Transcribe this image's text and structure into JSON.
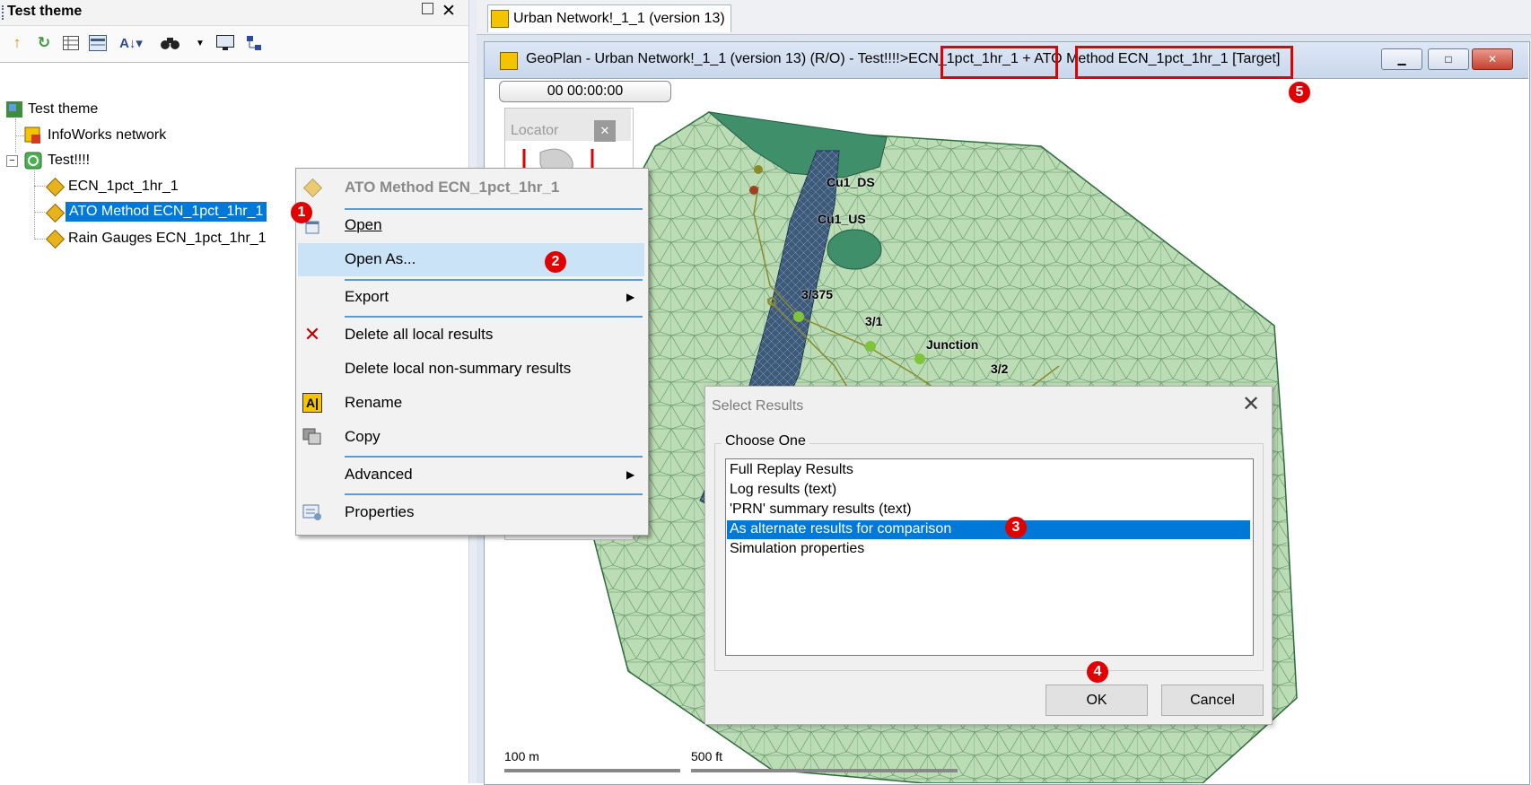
{
  "left_panel": {
    "title": "Test theme",
    "close_glyph": "✕",
    "toolbar_icons": [
      "up-arrow-icon",
      "refresh-icon",
      "grid-icon",
      "table-icon",
      "sort-az-icon",
      "binoculars-icon",
      "monitor-icon",
      "tree-icon"
    ],
    "tree": [
      {
        "label": "Test theme",
        "icon": "theme-icon"
      },
      {
        "label": "InfoWorks network",
        "icon": "network-icon"
      },
      {
        "label": "Test!!!!",
        "icon": "run-icon"
      },
      {
        "label": "ECN_1pct_1hr_1",
        "icon": "sim-diamond-icon"
      },
      {
        "label": "ATO Method ECN_1pct_1hr_1",
        "icon": "sim-diamond-icon",
        "selected": true
      },
      {
        "label": "Rain Gauges ECN_1pct_1hr_1",
        "icon": "sim-diamond-icon"
      }
    ]
  },
  "tabs": [
    {
      "label": "Urban Network!_1_1 (version 13)"
    }
  ],
  "geoplan": {
    "title_prefix": "GeoPlan - Urban Network!_1_1 (version 13) (R/O) - Test!!!!>",
    "title_sim1": "ECN_1pct_1hr_1",
    "title_plus": " + ",
    "title_sim2": "ATO Method ECN_1pct_1hr_1",
    "title_suffix": " [Target]",
    "time": "00 00:00:00",
    "locator_title": "Locator",
    "map_labels": [
      "Cu1_DS",
      "Cu1_US",
      "3/375",
      "3/1",
      "Junction",
      "3/2"
    ],
    "scale_m": "100 m",
    "scale_ft": "500 ft"
  },
  "context_menu": {
    "header": "ATO Method ECN_1pct_1hr_1",
    "items": [
      {
        "label": "Open"
      },
      {
        "label": "Open As..."
      },
      {
        "label": "Export"
      },
      {
        "label": "Delete all local results"
      },
      {
        "label": "Delete local non-summary results"
      },
      {
        "label": "Rename"
      },
      {
        "label": "Copy"
      },
      {
        "label": "Advanced"
      },
      {
        "label": "Properties"
      }
    ]
  },
  "dialog": {
    "title": "Select Results",
    "group_label": "Choose One",
    "options": [
      "Full Replay Results",
      "Log results (text)",
      "'PRN' summary results (text)",
      "As alternate results for comparison",
      "Simulation properties"
    ],
    "selected_index": 3,
    "ok_label": "OK",
    "cancel_label": "Cancel"
  },
  "markers": [
    "1",
    "2",
    "3",
    "4",
    "5"
  ],
  "colors": {
    "mesh_fill": "#bcdcb6",
    "mesh_line": "#2d6b3a",
    "river_fill": "#3d5a7a",
    "highlight_red": "#e00000",
    "selection_blue": "#0078d7"
  }
}
